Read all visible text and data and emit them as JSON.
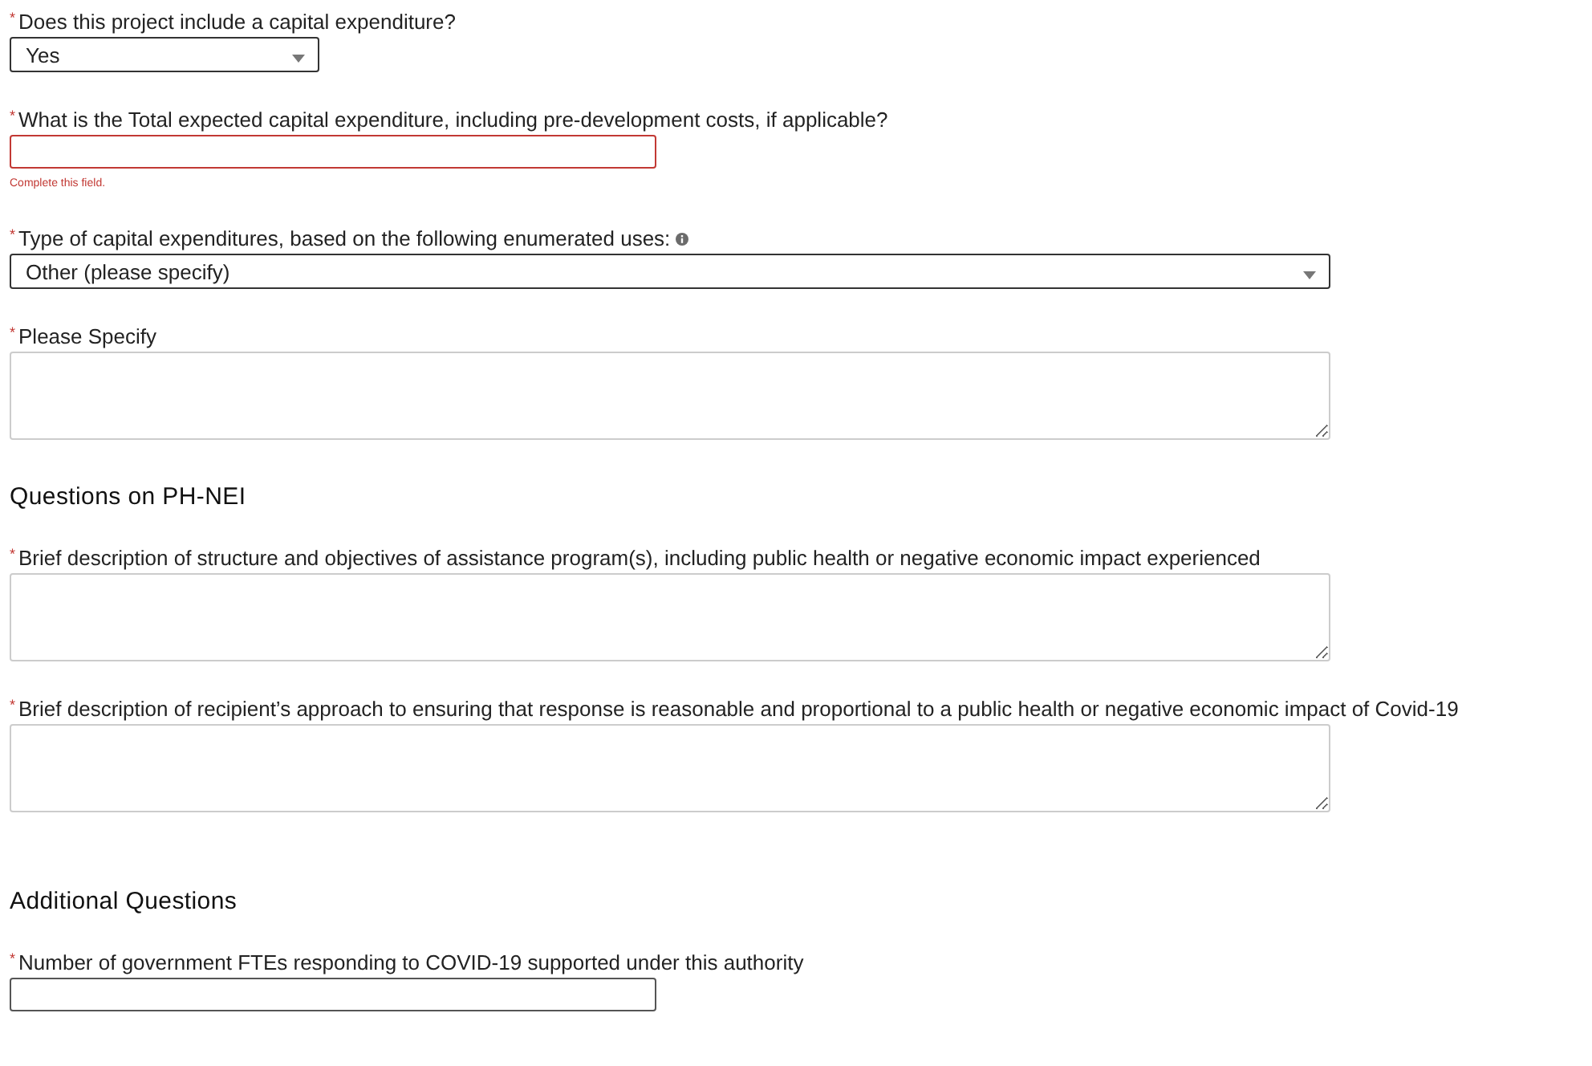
{
  "items": [
    {
      "kind": "select",
      "required_mark": "*",
      "label": "Does this project include a capital expenditure?",
      "value": "Yes"
    },
    {
      "kind": "text",
      "required_mark": "*",
      "label": "What is the Total expected capital expenditure, including pre-development costs, if applicable?",
      "error": "Complete this field."
    },
    {
      "kind": "select",
      "required_mark": "*",
      "label": "Type of capital expenditures, based on the following enumerated uses:",
      "help_icon": true,
      "value": "Other (please specify)"
    },
    {
      "kind": "textarea",
      "required_mark": "*",
      "label": "Please Specify"
    },
    {
      "kind": "heading",
      "label": "Questions on PH-NEI"
    },
    {
      "kind": "textarea",
      "required_mark": "*",
      "label": "Brief description of structure and objectives of assistance program(s), including public health or negative economic impact experienced"
    },
    {
      "kind": "textarea",
      "required_mark": "*",
      "label": "Brief description of recipient’s approach to ensuring that response is reasonable and proportional to a public health or negative economic impact of Covid-19"
    },
    {
      "kind": "heading",
      "label": "Additional Questions"
    },
    {
      "kind": "text",
      "required_mark": "*",
      "label": "Number of government FTEs responding to COVID-19 supported under this authority"
    }
  ]
}
